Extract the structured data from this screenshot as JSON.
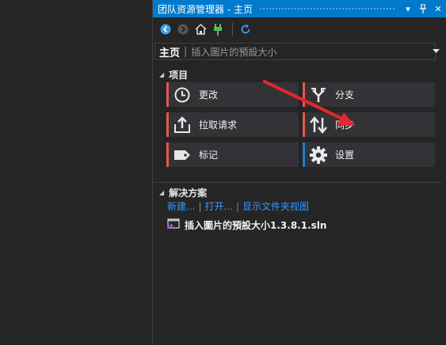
{
  "panel": {
    "title": "团队资源管理器 - 主页",
    "header_home": "主页",
    "header_project": "插入圖片的預設大小"
  },
  "icons": {
    "toolbar": [
      "back-icon",
      "forward-icon",
      "home-icon",
      "plug-icon",
      "refresh-icon"
    ],
    "title_buttons": [
      "dropdown-arrow-icon",
      "pin-icon",
      "close-icon"
    ]
  },
  "sections": {
    "project_label": "项目",
    "solutions_label": "解决方案"
  },
  "tiles": [
    {
      "label": "更改",
      "icon": "clock-icon",
      "accent": "#e05a4f"
    },
    {
      "label": "分支",
      "icon": "branch-icon",
      "accent": "#e05a4f"
    },
    {
      "label": "拉取请求",
      "icon": "pull-request-icon",
      "accent": "#e05a4f"
    },
    {
      "label": "同步",
      "icon": "sync-icon",
      "accent": "#e05a4f"
    },
    {
      "label": "标记",
      "icon": "tag-icon",
      "accent": "#e05a4f"
    },
    {
      "label": "设置",
      "icon": "gear-icon",
      "accent": "#1e7fd0"
    }
  ],
  "solution_links": {
    "new": "新建...",
    "open": "打开...",
    "folder_view": "显示文件夹视图"
  },
  "solution_file": "插入圖片的預設大小1.3.8.1.sln",
  "colors": {
    "titlebar": "#007acc",
    "background": "#252526",
    "tile_bg": "#333337",
    "link": "#3399ff",
    "annotation_arrow": "#e8262c"
  }
}
